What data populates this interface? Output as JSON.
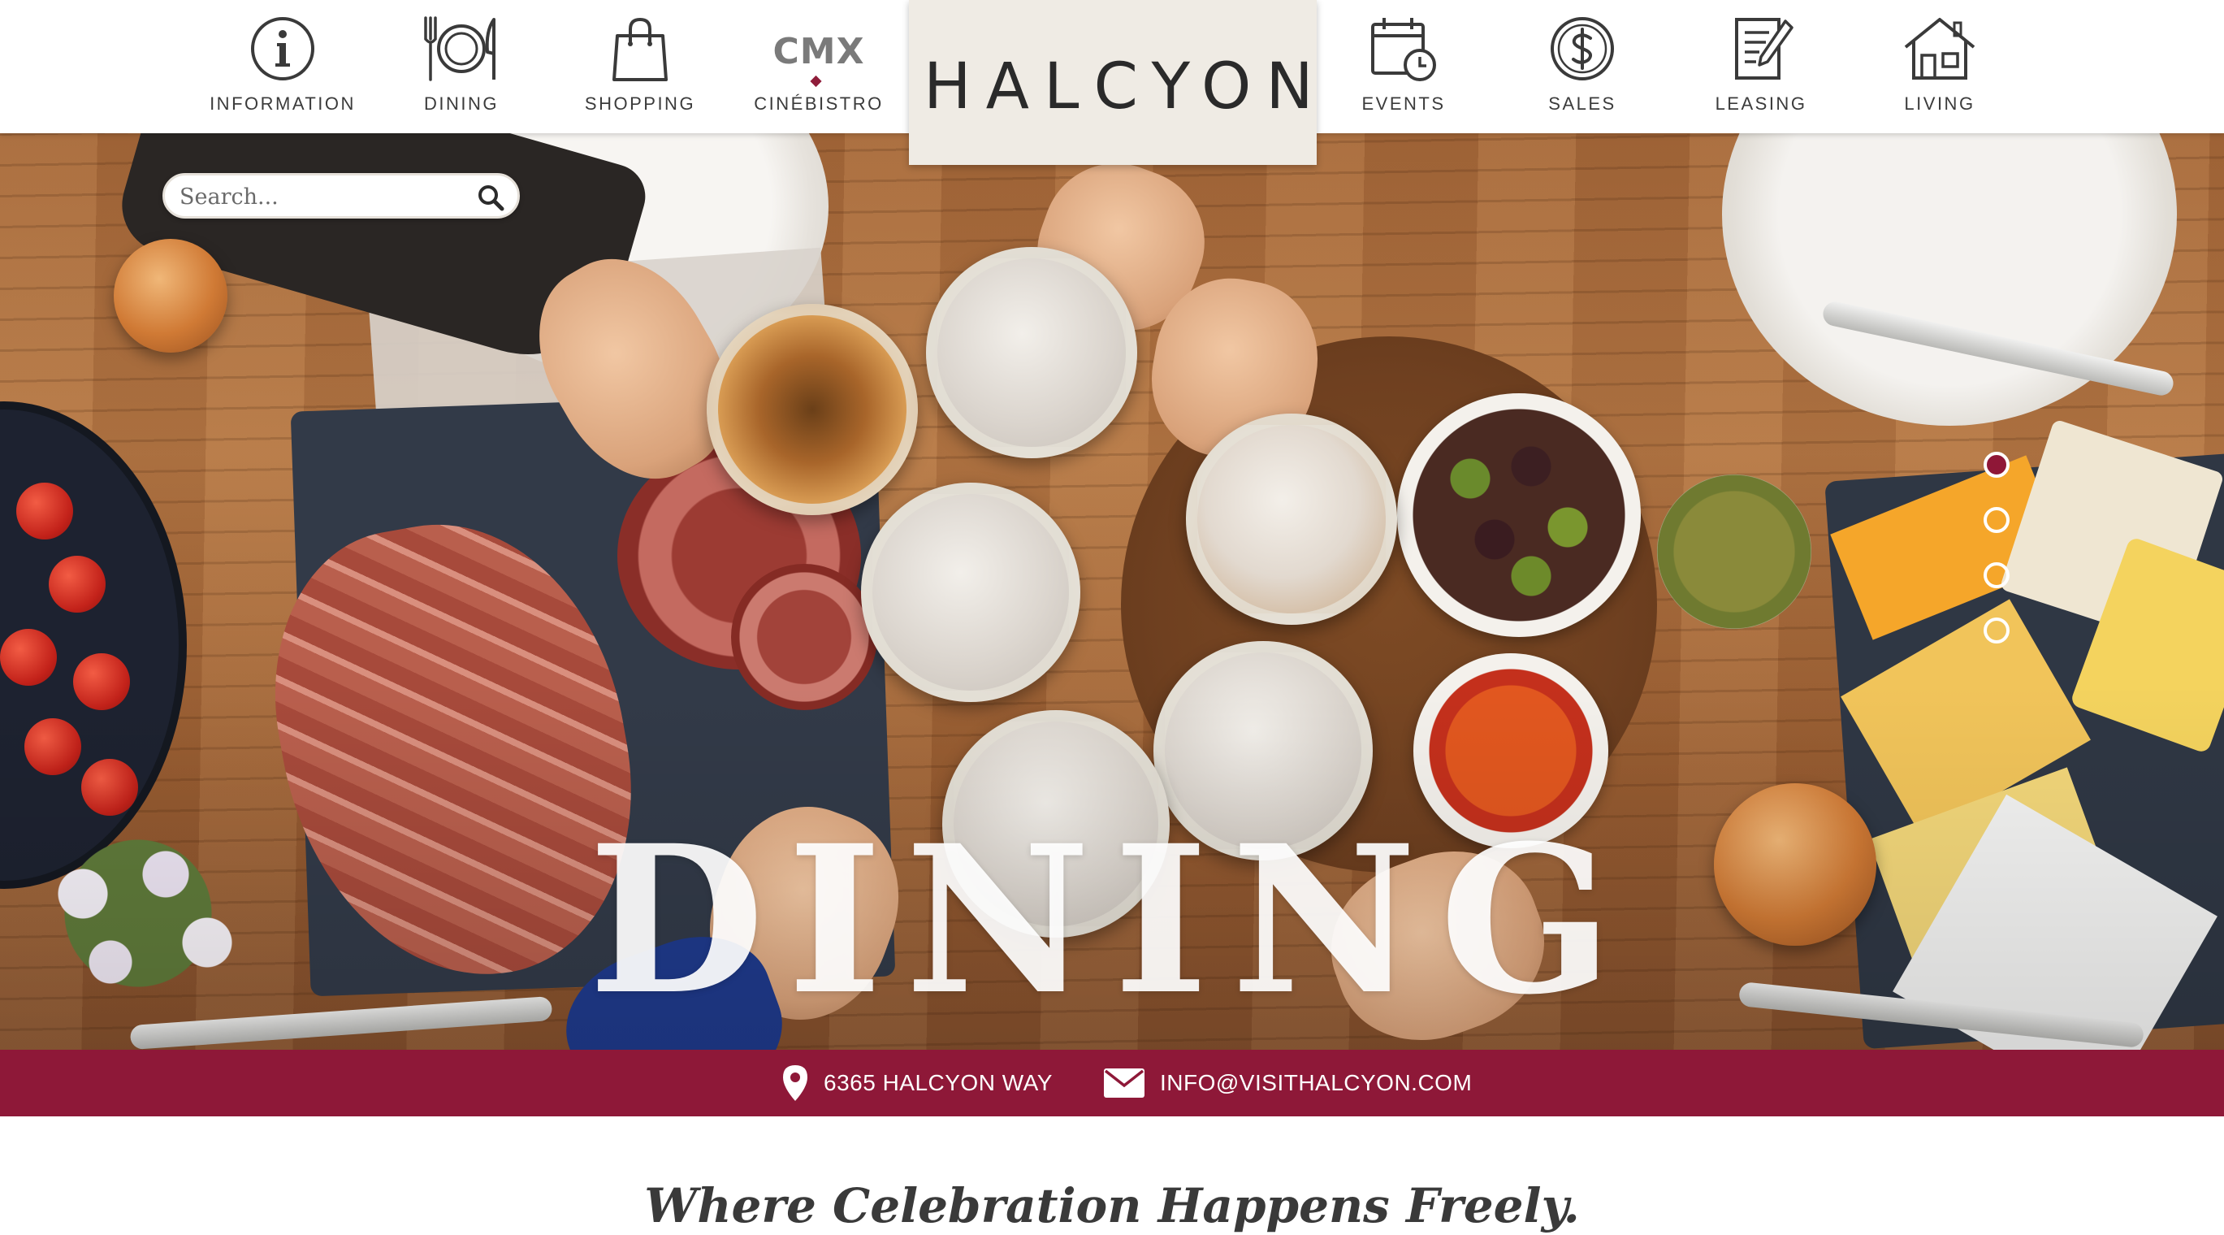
{
  "nav": {
    "items": [
      {
        "label": "INFORMATION",
        "icon": "info-icon"
      },
      {
        "label": "DINING",
        "icon": "plate-utensils-icon"
      },
      {
        "label": "SHOPPING",
        "icon": "shopping-bag-icon"
      },
      {
        "label": "CINÉBISTRO",
        "icon": "cmx-logo",
        "logo_text": "CMX"
      },
      {
        "label": "EVENTS",
        "icon": "calendar-clock-icon"
      },
      {
        "label": "SALES",
        "icon": "dollar-circle-icon"
      },
      {
        "label": "LEASING",
        "icon": "document-pen-icon"
      },
      {
        "label": "LIVING",
        "icon": "house-icon"
      }
    ]
  },
  "brand": {
    "name": "HALCYON",
    "background": "#efebe4"
  },
  "search": {
    "placeholder": "Search...",
    "value": ""
  },
  "hero": {
    "title": "DINING",
    "slides": 4,
    "active_slide": 0
  },
  "contact": {
    "address": "6365 HALCYON WAY",
    "email": "INFO@VISITHALCYON.COM",
    "background": "#8e1838"
  },
  "tagline": "Where Celebration Happens Freely.",
  "colors": {
    "accent": "#8e1838",
    "text": "#3b3b3b"
  }
}
